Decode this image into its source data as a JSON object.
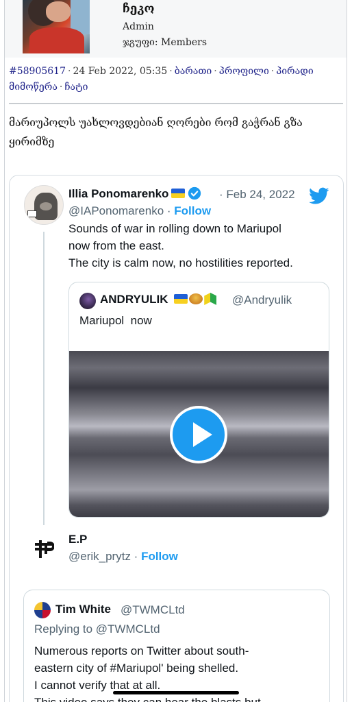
{
  "forum": {
    "author_name": "ჩეკო",
    "author_role": "Admin",
    "author_group": "ჯგუფი: Members",
    "post_id": "#58905617",
    "post_date": "24 Feb 2022, 05:35",
    "links": [
      "ბარათი",
      "პროფილი",
      "პირადი მიმოწერა",
      "ჩატი"
    ],
    "separator": "·",
    "post_text": "მარიუპოლს უახლოვდებიან ღორები რომ გაჭრან გზა ყირიმზე"
  },
  "tweet": {
    "author_name": "Illia Ponomarenko",
    "date": "· Feb 24, 2022",
    "handle": "@IAPonomarenko",
    "follow_label": "Follow",
    "body_lines": [
      "Sounds of war in rolling down to Mariupol",
      "now from the east.",
      "The city is calm now, no hostilities reported."
    ],
    "quote": {
      "author_name": "ANDRYULIK",
      "handle": "@Andryulik",
      "text": "Mariupol  now",
      "media": "video-thumbnail"
    }
  },
  "reply": {
    "author_name": "E.P",
    "handle": "@erik_prytz",
    "follow_label": "Follow",
    "quote": {
      "author_name": "Tim White",
      "handle": "@TWMCLtd",
      "replying_to": "Replying to @TWMCLtd",
      "body_lines": [
        "Numerous reports on Twitter about south-",
        "eastern city of #Mariupol' being shelled.",
        "I cannot verify that at all.",
        "This video says they can hear the blasts but"
      ]
    }
  },
  "colors": {
    "link": "#20248a",
    "twitter_blue": "#1d9bf0",
    "muted": "#536471"
  }
}
